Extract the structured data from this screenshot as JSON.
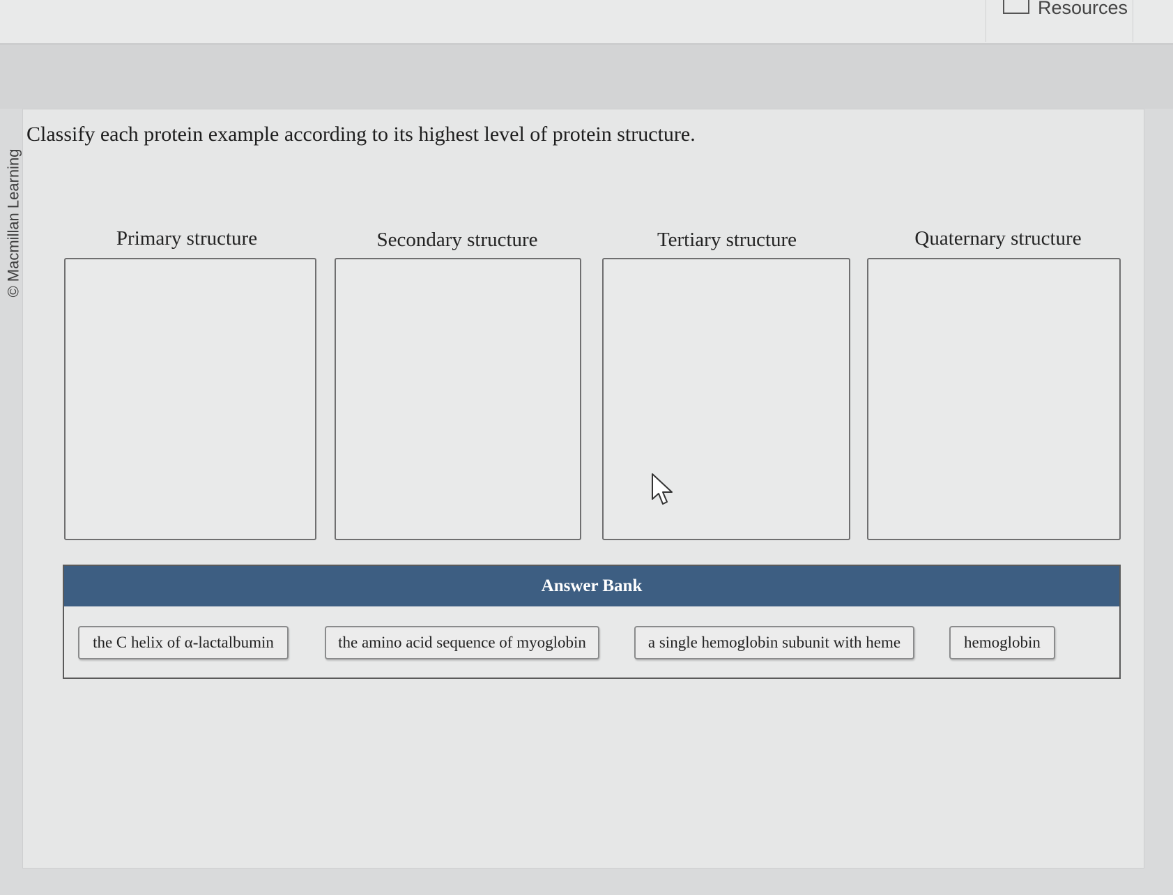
{
  "header": {
    "resources_label": "Resources",
    "resources_icon": "book-icon"
  },
  "watermark": "© Macmillan Learning",
  "question": {
    "instruction": "Classify each protein example according to its highest level of protein structure."
  },
  "categories": [
    {
      "label": "Primary structure"
    },
    {
      "label": "Secondary structure"
    },
    {
      "label": "Tertiary structure"
    },
    {
      "label": "Quaternary structure"
    }
  ],
  "answer_bank": {
    "title": "Answer Bank",
    "header_color": "#3d5e82",
    "items": [
      {
        "label": "the C helix of α-lactalbumin"
      },
      {
        "label": "the amino acid sequence of myoglobin"
      },
      {
        "label": "a single hemoglobin subunit with heme"
      },
      {
        "label": "hemoglobin"
      }
    ]
  }
}
